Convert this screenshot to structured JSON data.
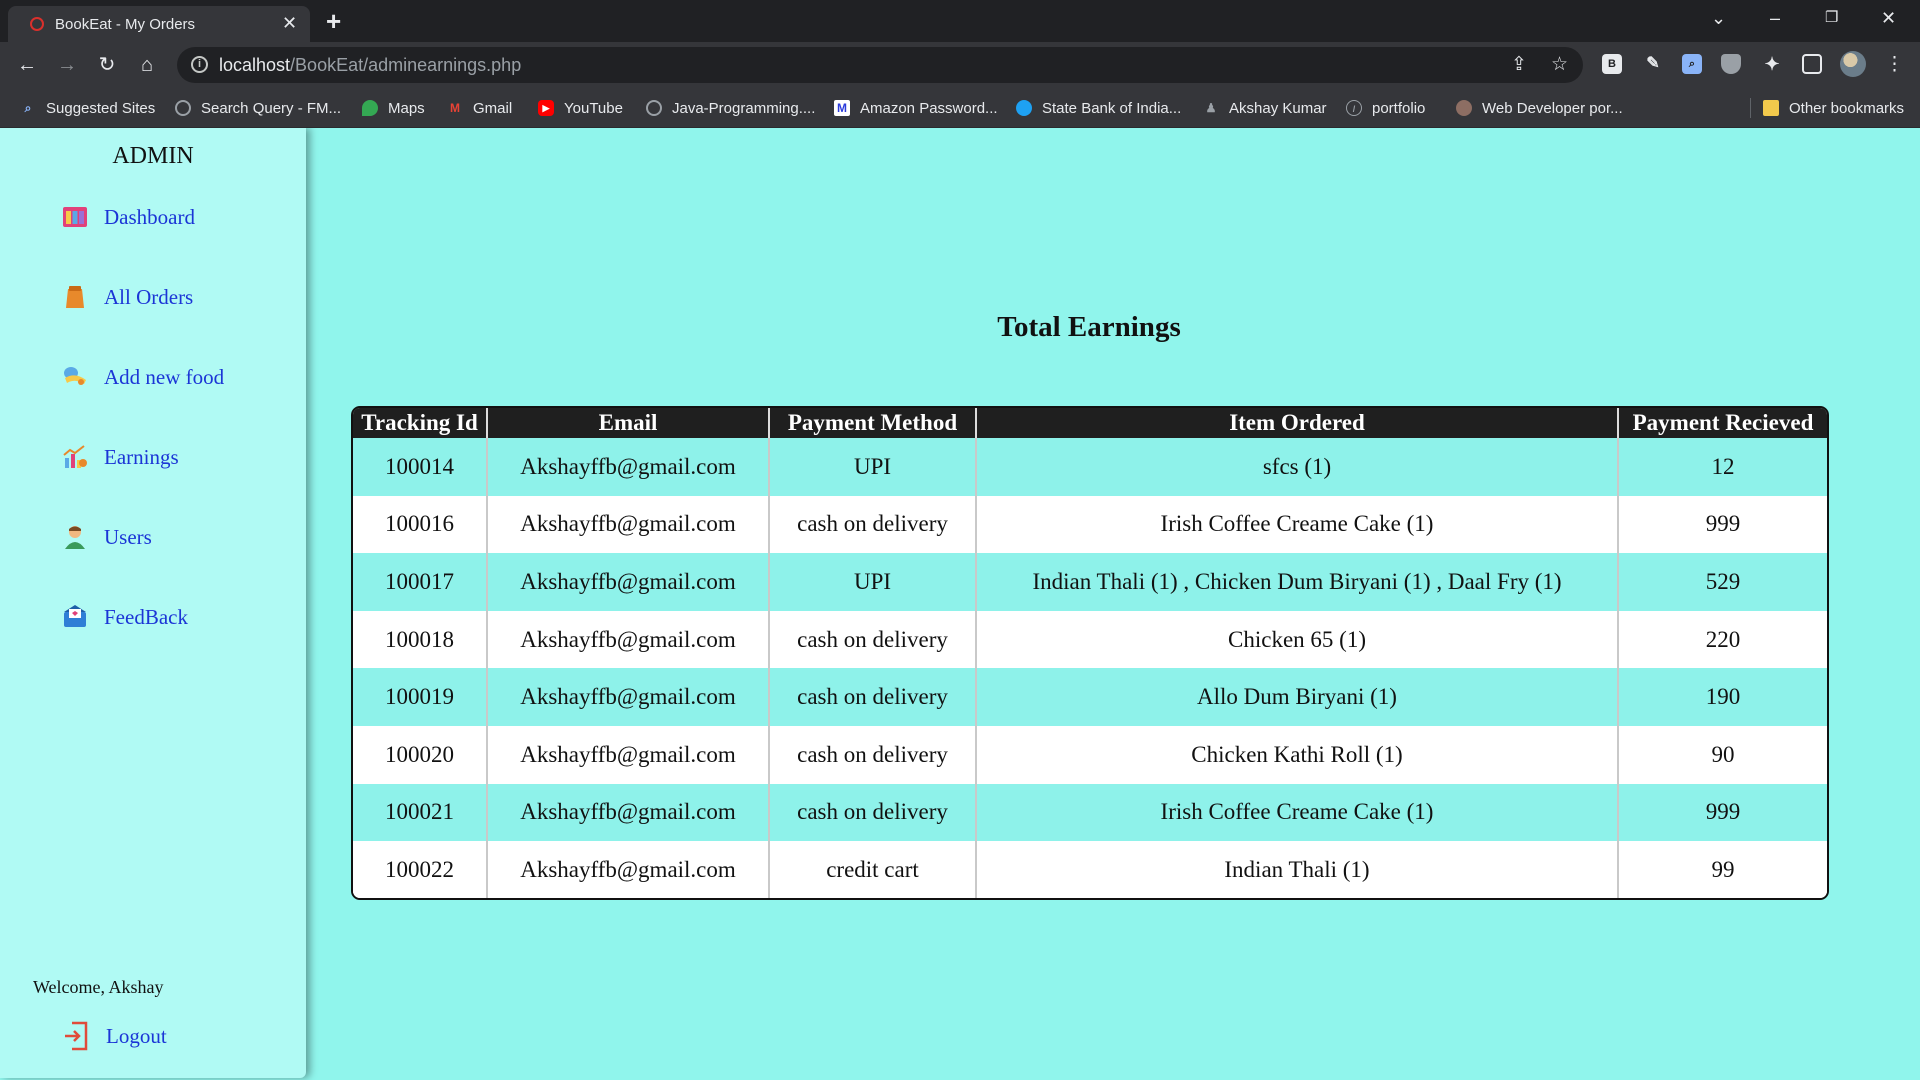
{
  "browser": {
    "tab_title": "BookEat - My Orders",
    "tab_close": "✕",
    "new_tab": "+",
    "url_host": "localhost",
    "url_path": "/BookEat/adminearnings.php",
    "info_glyph": "i",
    "ext_b": "B",
    "bookmarks": [
      {
        "label": "Suggested Sites",
        "icon": "search-icon",
        "color": "#8ab4f8"
      },
      {
        "label": "Search Query - FM...",
        "icon": "globe-icon",
        "color": "#9aa0a6"
      },
      {
        "label": "Maps",
        "icon": "maps-pin-icon",
        "color": "#34a853"
      },
      {
        "label": "Gmail",
        "icon": "gmail-icon",
        "color": "#ea4335"
      },
      {
        "label": "YouTube",
        "icon": "youtube-icon",
        "color": "#ff0000"
      },
      {
        "label": "Java-Programming....",
        "icon": "globe-icon",
        "color": "#9aa0a6"
      },
      {
        "label": "Amazon Password...",
        "icon": "m-logo-icon",
        "color": "#2b3bdb"
      },
      {
        "label": "State Bank of India...",
        "icon": "sbi-logo-icon",
        "color": "#1ea1f2"
      },
      {
        "label": "Akshay Kumar",
        "icon": "person-icon",
        "color": "#9aa0a6"
      },
      {
        "label": "portfolio",
        "icon": "code-icon",
        "color": "#5f6368"
      },
      {
        "label": "Web Developer por...",
        "icon": "avatar-icon",
        "color": "#8d6e63"
      }
    ],
    "other_bookmarks": "Other bookmarks"
  },
  "sidebar": {
    "title": "ADMIN",
    "items": [
      {
        "label": "Dashboard",
        "icon": "dashboard-icon"
      },
      {
        "label": "All Orders",
        "icon": "orders-icon"
      },
      {
        "label": "Add new food",
        "icon": "food-icon"
      },
      {
        "label": "Earnings",
        "icon": "earnings-chart-icon"
      },
      {
        "label": "Users",
        "icon": "users-icon"
      },
      {
        "label": "FeedBack",
        "icon": "feedback-icon"
      }
    ],
    "welcome": "Welcome, Akshay",
    "logout": "Logout"
  },
  "main": {
    "heading": "Total Earnings",
    "columns": [
      "Tracking Id",
      "Email",
      "Payment Method",
      "Item Ordered",
      "Payment Recieved"
    ],
    "rows": [
      [
        "100014",
        "Akshayffb@gmail.com",
        "UPI",
        "sfcs (1)",
        "12"
      ],
      [
        "100016",
        "Akshayffb@gmail.com",
        "cash on delivery",
        "Irish Coffee Creame Cake (1)",
        "999"
      ],
      [
        "100017",
        "Akshayffb@gmail.com",
        "UPI",
        "Indian Thali (1) , Chicken Dum Biryani (1) , Daal Fry (1)",
        "529"
      ],
      [
        "100018",
        "Akshayffb@gmail.com",
        "cash on delivery",
        "Chicken 65 (1)",
        "220"
      ],
      [
        "100019",
        "Akshayffb@gmail.com",
        "cash on delivery",
        "Allo Dum Biryani (1)",
        "190"
      ],
      [
        "100020",
        "Akshayffb@gmail.com",
        "cash on delivery",
        "Chicken Kathi Roll (1)",
        "90"
      ],
      [
        "100021",
        "Akshayffb@gmail.com",
        "cash on delivery",
        "Irish Coffee Creame Cake (1)",
        "999"
      ],
      [
        "100022",
        "Akshayffb@gmail.com",
        "credit cart",
        "Indian Thali (1)",
        "99"
      ]
    ]
  },
  "colors": {
    "page_bg": "#90f5ec",
    "sidebar_bg": "#b0faf4",
    "link": "#1b35d6",
    "header_bg": "#1f1f1f",
    "row_alt": "#8ef2ea"
  }
}
